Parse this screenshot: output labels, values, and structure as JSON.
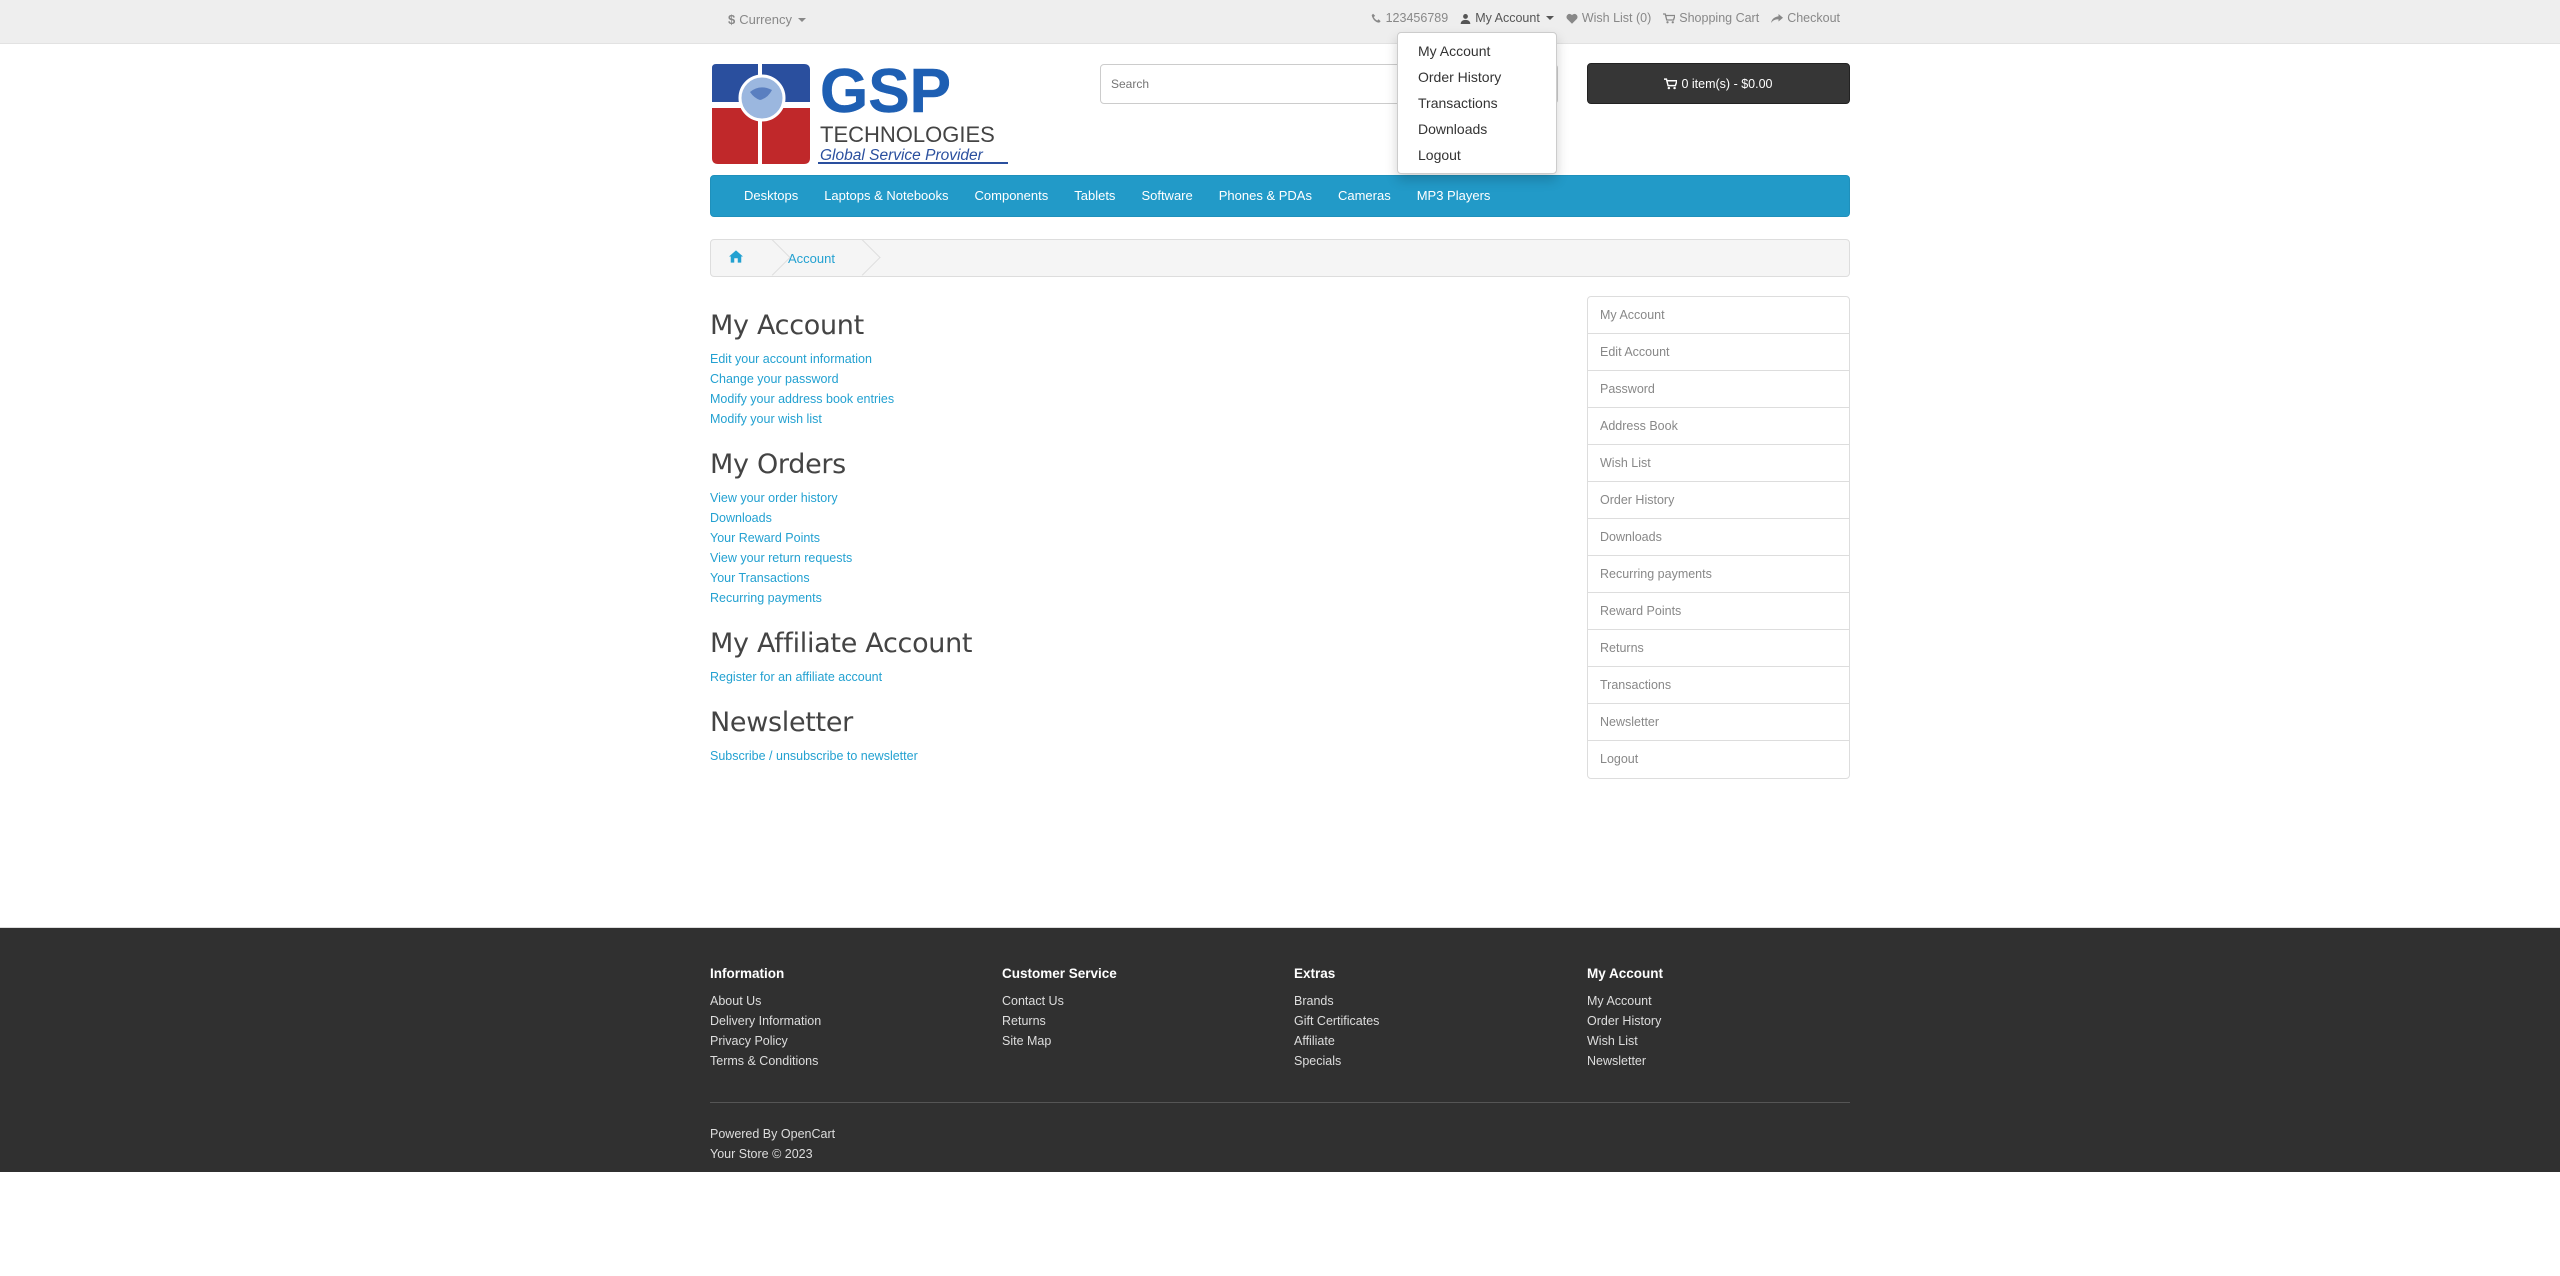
{
  "topbar": {
    "currency_symbol": "$",
    "currency_label": "Currency",
    "phone": "123456789",
    "my_account": "My Account",
    "wish_list": "Wish List (0)",
    "shopping_cart": "Shopping Cart",
    "checkout": "Checkout"
  },
  "account_dropdown": {
    "items": [
      "My Account",
      "Order History",
      "Transactions",
      "Downloads",
      "Logout"
    ]
  },
  "logo": {
    "brand": "GSP",
    "line1": "TECHNOLOGIES",
    "line2": "Global Service Provider"
  },
  "search": {
    "placeholder": "Search"
  },
  "cart": {
    "label": "0 item(s) - $0.00"
  },
  "menu": {
    "items": [
      "Desktops",
      "Laptops & Notebooks",
      "Components",
      "Tablets",
      "Software",
      "Phones & PDAs",
      "Cameras",
      "MP3 Players"
    ]
  },
  "breadcrumb": {
    "current": "Account"
  },
  "content": {
    "sections": [
      {
        "title": "My Account",
        "links": [
          "Edit your account information",
          "Change your password",
          "Modify your address book entries",
          "Modify your wish list"
        ]
      },
      {
        "title": "My Orders",
        "links": [
          "View your order history",
          "Downloads",
          "Your Reward Points",
          "View your return requests",
          "Your Transactions",
          "Recurring payments"
        ]
      },
      {
        "title": "My Affiliate Account",
        "links": [
          "Register for an affiliate account"
        ]
      },
      {
        "title": "Newsletter",
        "links": [
          "Subscribe / unsubscribe to newsletter"
        ]
      }
    ]
  },
  "sidebar": {
    "items": [
      "My Account",
      "Edit Account",
      "Password",
      "Address Book",
      "Wish List",
      "Order History",
      "Downloads",
      "Recurring payments",
      "Reward Points",
      "Returns",
      "Transactions",
      "Newsletter",
      "Logout"
    ]
  },
  "footer": {
    "columns": [
      {
        "title": "Information",
        "links": [
          "About Us",
          "Delivery Information",
          "Privacy Policy",
          "Terms & Conditions"
        ]
      },
      {
        "title": "Customer Service",
        "links": [
          "Contact Us",
          "Returns",
          "Site Map"
        ]
      },
      {
        "title": "Extras",
        "links": [
          "Brands",
          "Gift Certificates",
          "Affiliate",
          "Specials"
        ]
      },
      {
        "title": "My Account",
        "links": [
          "My Account",
          "Order History",
          "Wish List",
          "Newsletter"
        ]
      }
    ],
    "powered_prefix": "Powered By",
    "powered_link": "OpenCart",
    "copyright": "Your Store © 2023"
  },
  "colors": {
    "menu_bg": "#229ac8",
    "link": "#23a1d1",
    "footer_bg": "#303030",
    "cart_bg": "#363636"
  }
}
